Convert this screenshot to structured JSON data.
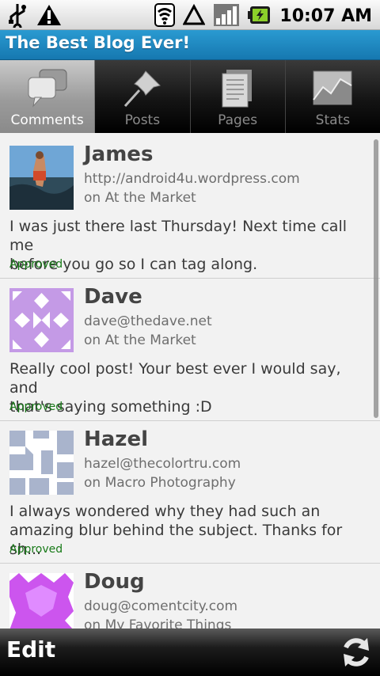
{
  "status_bar": {
    "time": "10:07 AM",
    "icons": [
      "usb-icon",
      "warning-icon",
      "wifi-icon",
      "sync-icon",
      "signal-icon",
      "battery-charging-icon"
    ]
  },
  "app": {
    "title": "The Best Blog Ever!"
  },
  "tabs": [
    {
      "label": "Comments",
      "icon": "speech-bubbles-icon",
      "active": true
    },
    {
      "label": "Posts",
      "icon": "pushpin-icon",
      "active": false
    },
    {
      "label": "Pages",
      "icon": "pages-icon",
      "active": false
    },
    {
      "label": "Stats",
      "icon": "stats-chart-icon",
      "active": false
    }
  ],
  "comments": [
    {
      "name": "James",
      "email": "http://android4u.wordpress.com",
      "post": "on At the Market",
      "body": "I was just there last Thursday!  Next time call me\nbefore you go so I can tag along.",
      "status": "Approved"
    },
    {
      "name": "Dave",
      "email": "dave@thedave.net",
      "post": "on At the Market",
      "body": "Really cool post!  Your best ever I would say, and\nthat's saying something :D",
      "status": "Approved"
    },
    {
      "name": "Hazel",
      "email": "hazel@thecolortru.com",
      "post": "on Macro Photography",
      "body": "I always wondered why they had such an\namazing blur behind the subject.  Thanks for sh...",
      "status": "Approved"
    },
    {
      "name": "Doug",
      "email": "doug@comentcity.com",
      "post": "on My Favorite Things",
      "body": "",
      "status": ""
    }
  ],
  "bottom_bar": {
    "edit_label": "Edit",
    "refresh_icon": "refresh-icon"
  },
  "colors": {
    "title_bar": "#1e88c2",
    "approved": "#187a18"
  }
}
